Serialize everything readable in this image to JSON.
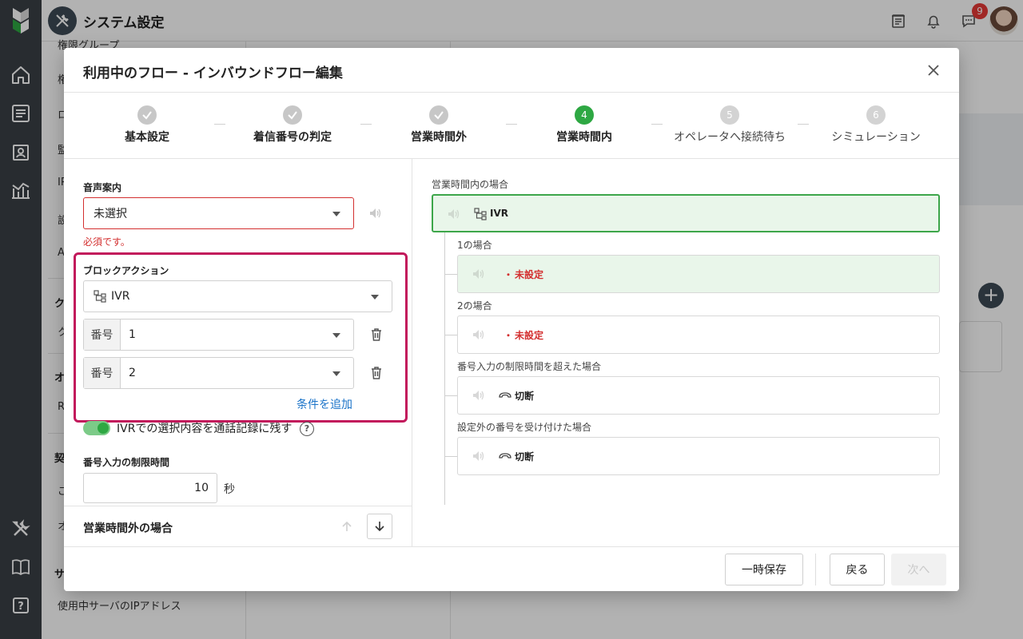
{
  "app": {
    "title": "システム設定",
    "notification_count": "9"
  },
  "sidemenu": {
    "partial_items": [
      "権限グループ",
      "権",
      "ロ",
      "監",
      "IP",
      "設",
      "A",
      "ク",
      "ク",
      "オ",
      "R",
      "契",
      "ご",
      "オ",
      "サ"
    ],
    "last_item": "使用中サーバのIPアドレス"
  },
  "modal": {
    "title": "利用中のフロー - インバウンドフロー編集",
    "steps": [
      {
        "num": "1",
        "label": "基本設定",
        "state": "done"
      },
      {
        "num": "2",
        "label": "着信番号の判定",
        "state": "done"
      },
      {
        "num": "3",
        "label": "営業時間外",
        "state": "done"
      },
      {
        "num": "4",
        "label": "営業時間内",
        "state": "active"
      },
      {
        "num": "5",
        "label": "オペレータへ接続待ち",
        "state": "todo"
      },
      {
        "num": "6",
        "label": "シミュレーション",
        "state": "todo"
      }
    ],
    "form": {
      "voice_label": "音声案内",
      "voice_value": "未選択",
      "voice_error": "必須です。",
      "block_action_label": "ブロックアクション",
      "block_action_value": "IVR",
      "number_prefix": "番号",
      "conditions": [
        "1",
        "2"
      ],
      "add_condition": "条件を追加",
      "record_toggle_label": "IVRでの選択内容を通話記録に残す",
      "record_toggle_on": true,
      "help": "?",
      "timeout_label": "番号入力の制限時間",
      "timeout_value": "10",
      "timeout_unit": "秒",
      "next_section": "営業時間外の場合"
    },
    "tree": {
      "root_label": "営業時間内の場合",
      "root_node": "IVR",
      "branches": [
        {
          "label": "1の場合",
          "dot": "・",
          "text": "未設定",
          "unset": true,
          "selected": true
        },
        {
          "label": "2の場合",
          "dot": "・",
          "text": "未設定",
          "unset": true,
          "selected": false
        },
        {
          "label": "番号入力の制限時間を超えた場合",
          "text": "切断",
          "unset": false,
          "selected": false
        },
        {
          "label": "設定外の番号を受け付けた場合",
          "text": "切断",
          "unset": false,
          "selected": false
        }
      ]
    },
    "footer": {
      "save_draft": "一時保存",
      "back": "戻る",
      "next": "次へ"
    }
  },
  "colors": {
    "accent_green": "#2ea843",
    "error_red": "#d32f2f",
    "highlight_magenta": "#c2185b",
    "link_blue": "#1a73c8"
  }
}
